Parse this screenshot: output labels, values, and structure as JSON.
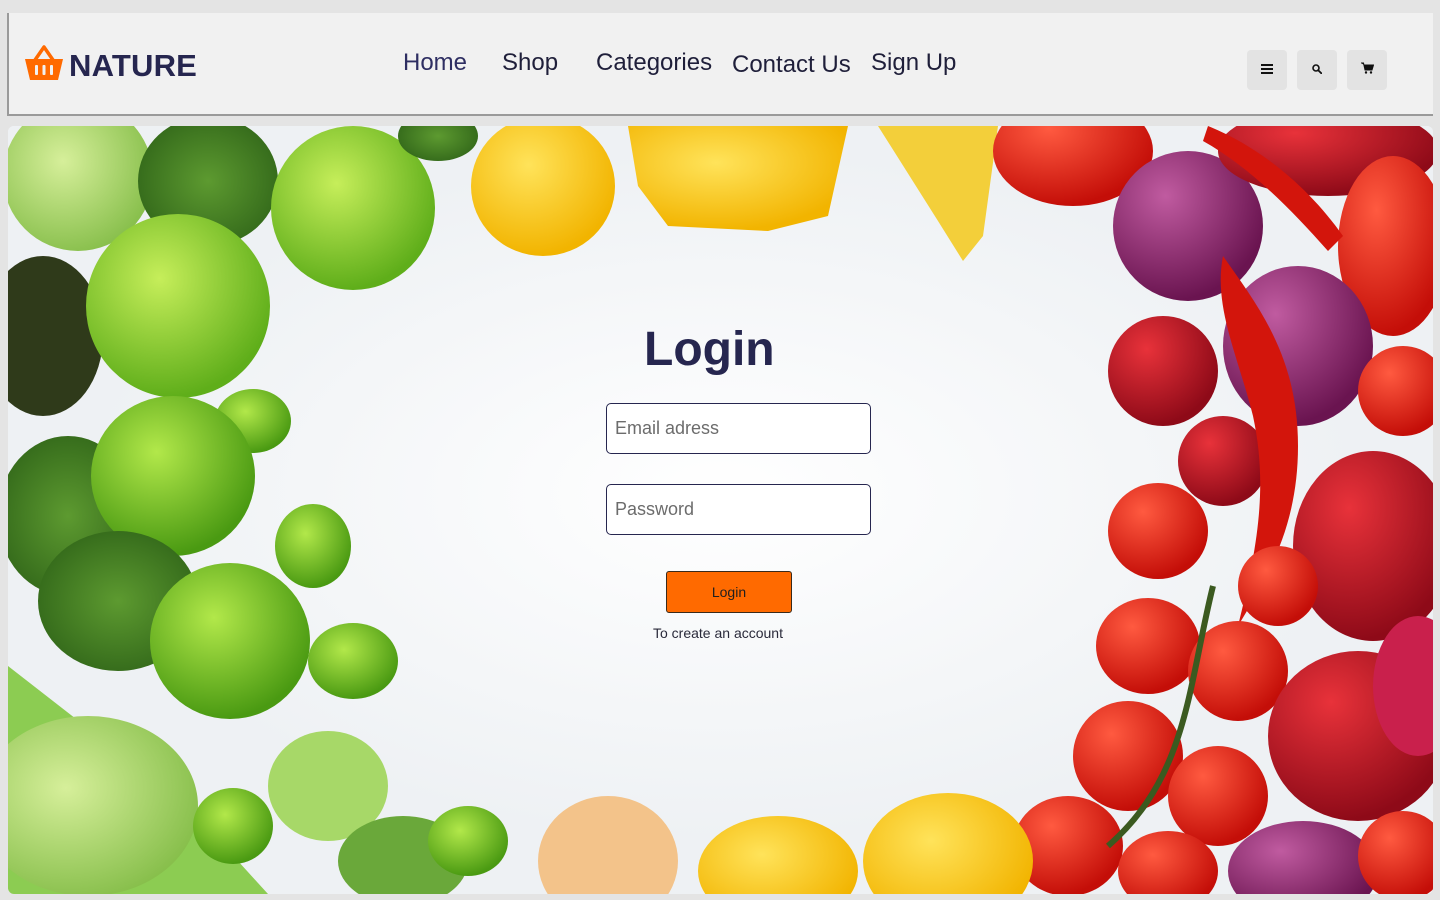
{
  "brand": {
    "name": "NATURE",
    "icon": "basket-icon",
    "accent": "#ff6a00",
    "text_color": "#26264f"
  },
  "nav": {
    "home": "Home",
    "shop": "Shop",
    "categories": "Categories",
    "contact": "Contact Us",
    "signup": "Sign Up"
  },
  "toolbar": {
    "menu_icon": "menu-icon",
    "search_icon": "search-icon",
    "cart_icon": "cart-icon"
  },
  "login": {
    "title": "Login",
    "email_placeholder": "Email adress",
    "password_placeholder": "Password",
    "button_label": "Login",
    "create_account": "To create an account"
  },
  "colors": {
    "page_bg": "#e4e4e4",
    "navbar_bg": "#f1f1f1",
    "button_orange": "#ff6a00"
  }
}
